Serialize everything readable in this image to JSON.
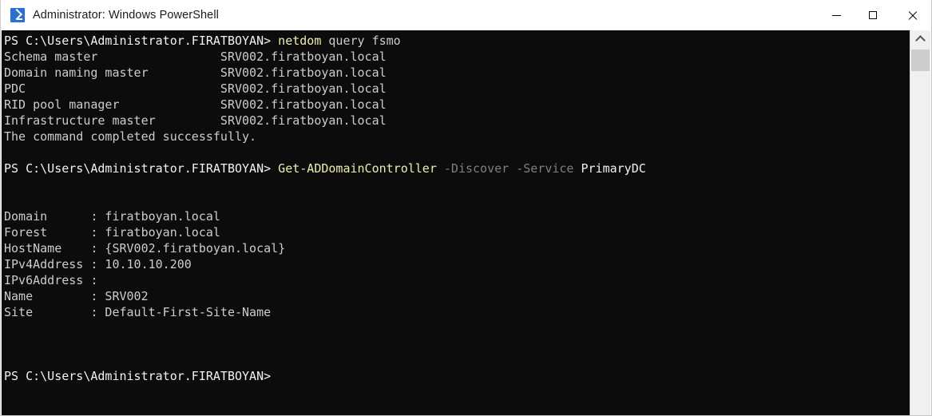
{
  "window": {
    "title": "Administrator: Windows PowerShell",
    "icon": "powershell-icon",
    "background": "#0c0c0c",
    "titlebar_background": "#ffffff",
    "controls": {
      "minimize_label": "Minimize",
      "maximize_label": "Maximize",
      "close_label": "Close"
    }
  },
  "colors": {
    "foreground": "#cccccc",
    "prompt": "#f2f2f2",
    "command": "#eeedb0",
    "parameter": "#7f7f7f",
    "argument": "#f2f2f2"
  },
  "scrollbar": {
    "up_arrow": "chevron-up-icon",
    "thumb_position_percent": 5
  },
  "console": {
    "prompt": "PS C:\\Users\\Administrator.FIRATBOYAN>",
    "lines": [
      {
        "kind": "prompt",
        "prompt": "PS C:\\Users\\Administrator.FIRATBOYAN>",
        "command": "netdom",
        "args": " query fsmo"
      },
      {
        "kind": "output",
        "text": "Schema master                 SRV002.firatboyan.local"
      },
      {
        "kind": "output",
        "text": "Domain naming master          SRV002.firatboyan.local"
      },
      {
        "kind": "output",
        "text": "PDC                           SRV002.firatboyan.local"
      },
      {
        "kind": "output",
        "text": "RID pool manager              SRV002.firatboyan.local"
      },
      {
        "kind": "output",
        "text": "Infrastructure master         SRV002.firatboyan.local"
      },
      {
        "kind": "output",
        "text": "The command completed successfully."
      },
      {
        "kind": "blank",
        "text": ""
      },
      {
        "kind": "prompt2",
        "prompt": "PS C:\\Users\\Administrator.FIRATBOYAN>",
        "command": "Get-ADDomainController",
        "params": " -Discover -Service",
        "argument": " PrimaryDC"
      },
      {
        "kind": "blank",
        "text": ""
      },
      {
        "kind": "blank",
        "text": ""
      },
      {
        "kind": "output",
        "text": "Domain      : firatboyan.local"
      },
      {
        "kind": "output",
        "text": "Forest      : firatboyan.local"
      },
      {
        "kind": "output",
        "text": "HostName    : {SRV002.firatboyan.local}"
      },
      {
        "kind": "output",
        "text": "IPv4Address : 10.10.10.200"
      },
      {
        "kind": "output",
        "text": "IPv6Address :"
      },
      {
        "kind": "output",
        "text": "Name        : SRV002"
      },
      {
        "kind": "output",
        "text": "Site        : Default-First-Site-Name"
      },
      {
        "kind": "blank",
        "text": ""
      },
      {
        "kind": "blank",
        "text": ""
      },
      {
        "kind": "blank",
        "text": ""
      },
      {
        "kind": "prompt-only",
        "prompt": "PS C:\\Users\\Administrator.FIRATBOYAN>"
      }
    ],
    "fsmo_roles": [
      {
        "role": "Schema master",
        "holder": "SRV002.firatboyan.local"
      },
      {
        "role": "Domain naming master",
        "holder": "SRV002.firatboyan.local"
      },
      {
        "role": "PDC",
        "holder": "SRV002.firatboyan.local"
      },
      {
        "role": "RID pool manager",
        "holder": "SRV002.firatboyan.local"
      },
      {
        "role": "Infrastructure master",
        "holder": "SRV002.firatboyan.local"
      }
    ],
    "domain_controller": {
      "Domain": "firatboyan.local",
      "Forest": "firatboyan.local",
      "HostName": "{SRV002.firatboyan.local}",
      "IPv4Address": "10.10.10.200",
      "IPv6Address": "",
      "Name": "SRV002",
      "Site": "Default-First-Site-Name"
    }
  }
}
